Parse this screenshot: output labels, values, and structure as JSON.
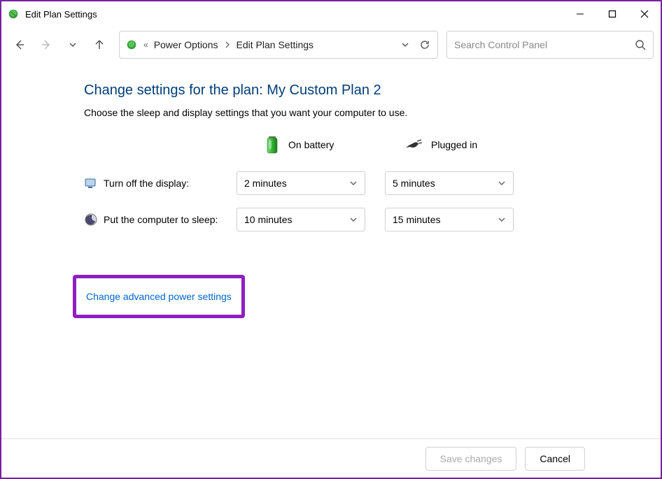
{
  "window": {
    "title": "Edit Plan Settings"
  },
  "breadcrumb": {
    "item1": "Power Options",
    "item2": "Edit Plan Settings"
  },
  "search": {
    "placeholder": "Search Control Panel"
  },
  "page": {
    "heading": "Change settings for the plan: My Custom Plan 2",
    "description": "Choose the sleep and display settings that you want your computer to use."
  },
  "modes": {
    "battery": "On battery",
    "plugged": "Plugged in"
  },
  "settings": {
    "display": {
      "label": "Turn off the display:",
      "battery_value": "2 minutes",
      "plugged_value": "5 minutes"
    },
    "sleep": {
      "label": "Put the computer to sleep:",
      "battery_value": "10 minutes",
      "plugged_value": "15 minutes"
    }
  },
  "links": {
    "advanced": "Change advanced power settings"
  },
  "buttons": {
    "save": "Save changes",
    "cancel": "Cancel"
  }
}
